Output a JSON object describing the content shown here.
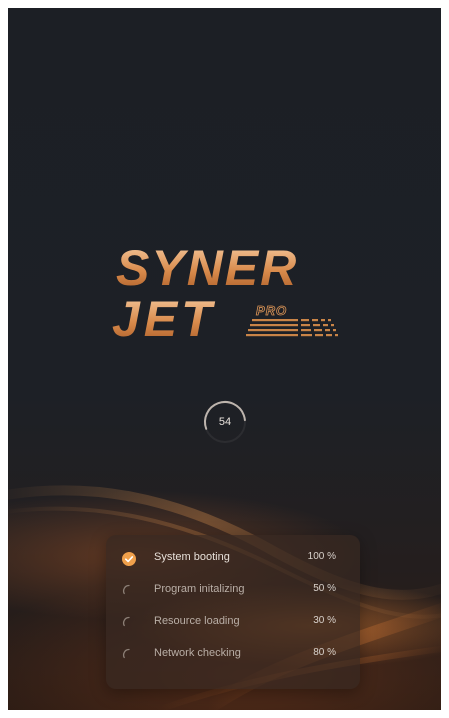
{
  "app": {
    "logo_line1": "SYNER",
    "logo_line2": "JET",
    "logo_badge": "PRO"
  },
  "progress": {
    "value": "54",
    "fraction": 0.54
  },
  "tasks": [
    {
      "label": "System booting",
      "percent": "100 %",
      "status": "done",
      "icon": "check-circle-icon"
    },
    {
      "label": "Program initalizing",
      "percent": "50 %",
      "status": "pending",
      "icon": "spinner-icon"
    },
    {
      "label": "Resource loading",
      "percent": "30 %",
      "status": "pending",
      "icon": "spinner-icon"
    },
    {
      "label": "Network checking",
      "percent": "80 %",
      "status": "pending",
      "icon": "spinner-icon"
    }
  ],
  "colors": {
    "accent": "#f0a04b",
    "logo_gradient_start": "#f6c69a",
    "logo_gradient_end": "#b86a30",
    "background": "#1c1f25"
  }
}
